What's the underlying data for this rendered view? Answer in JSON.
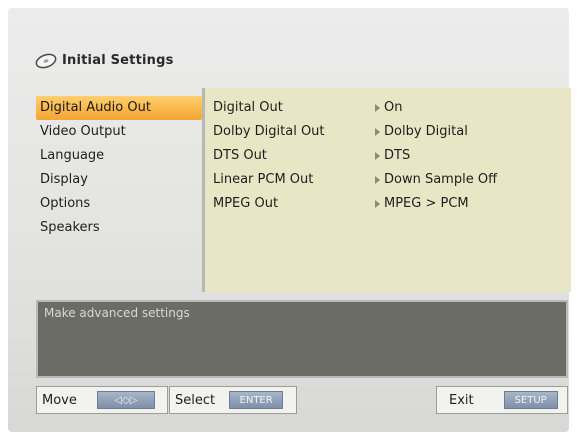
{
  "title": "Initial Settings",
  "menu": {
    "items": [
      {
        "label": "Digital Audio Out",
        "selected": true
      },
      {
        "label": "Video Output",
        "selected": false
      },
      {
        "label": "Language",
        "selected": false
      },
      {
        "label": "Display",
        "selected": false
      },
      {
        "label": "Options",
        "selected": false
      },
      {
        "label": "Speakers",
        "selected": false
      }
    ]
  },
  "settings": [
    {
      "label": "Digital Out",
      "value": "On"
    },
    {
      "label": "Dolby Digital Out",
      "value": "Dolby Digital"
    },
    {
      "label": "DTS Out",
      "value": "DTS"
    },
    {
      "label": "Linear PCM Out",
      "value": "Down Sample Off"
    },
    {
      "label": "MPEG Out",
      "value": "MPEG > PCM"
    }
  ],
  "help": {
    "text": "Make advanced settings"
  },
  "footer": {
    "move_label": "Move",
    "move_key": "◁◇▷",
    "select_label": "Select",
    "select_key": "ENTER",
    "exit_label": "Exit",
    "exit_key": "SETUP"
  },
  "colors": {
    "selected_highlight": "#f5a431",
    "panel_background": "#e8e6c4",
    "help_background": "#6c6c66",
    "key_button": "#8fa0b8"
  },
  "icons": {
    "title": "disc-icon",
    "value_marker": "arrow-right-icon"
  }
}
